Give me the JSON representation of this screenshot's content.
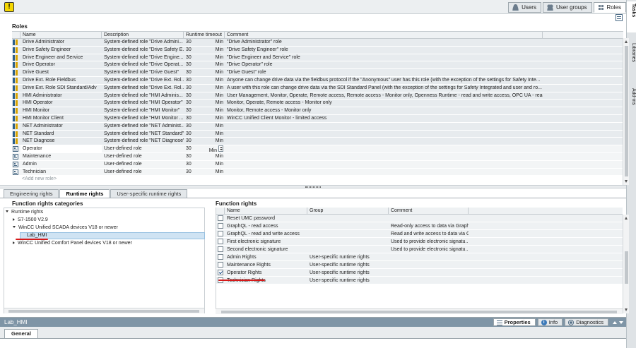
{
  "top_tabs": [
    {
      "label": "Users",
      "icon": "user-icon"
    },
    {
      "label": "User groups",
      "icon": "user-group-icon"
    },
    {
      "label": "Roles",
      "icon": "roles-icon",
      "active": true
    }
  ],
  "right_strip": {
    "tasks": "Tasks",
    "libraries": "Libraries",
    "addins": "Add-ins"
  },
  "roles": {
    "title": "Roles",
    "columns": [
      "Name",
      "Description",
      "Runtime timeout",
      "Comment"
    ],
    "rows": [
      {
        "name": "Drive Administrator",
        "desc": "System-defined role \"Drive Admini...",
        "timeout": "30",
        "unit": "Min",
        "comment": "\"Drive Administrator\" role",
        "type": "system"
      },
      {
        "name": "Drive Safety Engineer",
        "desc": "System-defined role \"Drive Safety E...",
        "timeout": "30",
        "unit": "Min",
        "comment": "\"Drive Safety Engineer\" role",
        "type": "system"
      },
      {
        "name": "Drive Engineer and Service",
        "desc": "System-defined role \"Drive Engine...",
        "timeout": "30",
        "unit": "Min",
        "comment": "\"Drive Engineer and Service\" role",
        "type": "system"
      },
      {
        "name": "Drive Operator",
        "desc": "System-defined role \"Drive Operat...",
        "timeout": "30",
        "unit": "Min",
        "comment": "\"Drive Operator\" role",
        "type": "system"
      },
      {
        "name": "Drive Guest",
        "desc": "System-defined role \"Drive Guest\"",
        "timeout": "30",
        "unit": "Min",
        "comment": "\"Drive Guest\" role",
        "type": "system"
      },
      {
        "name": "Drive Ext. Role Fieldbus",
        "desc": "System-defined role \"Drive Ext. Rol...",
        "timeout": "30",
        "unit": "Min",
        "comment": "Anyone can change drive data via the fieldbus protocol if the \"Anonymous\" user has this role (with the exception of the settings for Safety Inte...",
        "type": "system"
      },
      {
        "name": "Drive Ext. Role SDI Standard/Adv",
        "desc": "System-defined role \"Drive Ext. Rol...",
        "timeout": "30",
        "unit": "Min",
        "comment": "A user with this role can change drive data via the SDI Standard Panel (with the exception of the settings for Safety Integrated and user and ro...",
        "type": "system"
      },
      {
        "name": "HMI Administrator",
        "desc": "System-defined role \"HMI Adminis...",
        "timeout": "30",
        "unit": "Min",
        "comment": "User Management, Monitor, Operate, Remote access, Remote access - Monitor only, Openness Runtime - read and write access, OPC UA - read ...",
        "type": "system"
      },
      {
        "name": "HMI Operator",
        "desc": "System-defined role \"HMI Operator\"",
        "timeout": "30",
        "unit": "Min",
        "comment": "Monitor, Operate, Remote access - Monitor only",
        "type": "system"
      },
      {
        "name": "HMI Monitor",
        "desc": "System-defined role \"HMI Monitor\"",
        "timeout": "30",
        "unit": "Min",
        "comment": "Monitor, Remote access - Monitor only",
        "type": "system"
      },
      {
        "name": "HMI Monitor Client",
        "desc": "System-defined role \"HMI Monitor ...",
        "timeout": "30",
        "unit": "Min",
        "comment": "WinCC Unified Client Monitor - limited access",
        "type": "system"
      },
      {
        "name": "NET Administrator",
        "desc": "System-defined role \"NET Administ...",
        "timeout": "30",
        "unit": "Min",
        "comment": "",
        "type": "system"
      },
      {
        "name": "NET Standard",
        "desc": "System-defined role \"NET Standard\"",
        "timeout": "30",
        "unit": "Min",
        "comment": "",
        "type": "system"
      },
      {
        "name": "NET Diagnose",
        "desc": "System-defined role \"NET Diagnose\"",
        "timeout": "30",
        "unit": "Min",
        "comment": "",
        "type": "system"
      },
      {
        "name": "Operator",
        "desc": "User-defined role",
        "timeout": "30",
        "unit": "Min",
        "comment": "",
        "type": "user",
        "selected": true
      },
      {
        "name": "Maintenance",
        "desc": "User-defined role",
        "timeout": "30",
        "unit": "Min",
        "comment": "",
        "type": "user"
      },
      {
        "name": "Admin",
        "desc": "User-defined role",
        "timeout": "30",
        "unit": "Min",
        "comment": "",
        "type": "user"
      },
      {
        "name": "Technician",
        "desc": "User-defined role",
        "timeout": "30",
        "unit": "Min",
        "comment": "",
        "type": "user"
      }
    ],
    "add_new": "<Add new role>"
  },
  "lower_tabs": [
    "Engineering rights",
    "Runtime rights",
    "User-specific runtime rights"
  ],
  "categories": {
    "title": "Function rights categories",
    "root": "Runtime rights",
    "items": [
      {
        "label": "S7-1500 V2.9"
      },
      {
        "label": "WinCC Unified SCADA devices V18 or newer"
      },
      {
        "label": "Lab_HMI"
      },
      {
        "label": "WinCC Unified Comfort Panel devices V18 or newer"
      }
    ]
  },
  "function_rights": {
    "title": "Function rights",
    "columns": [
      "Name",
      "Group",
      "Comment"
    ],
    "rows": [
      {
        "name": "Reset UMC password",
        "group": "",
        "comment": "",
        "checked": false
      },
      {
        "name": "GraphQL - read access",
        "group": "",
        "comment": "Read-only access to data via Graph...",
        "checked": false
      },
      {
        "name": "GraphQL - read and write access",
        "group": "",
        "comment": "Read and write access to data via G...",
        "checked": false
      },
      {
        "name": "First electronic signature",
        "group": "",
        "comment": "Used to provide electronic signatu...",
        "checked": false
      },
      {
        "name": "Second electronic signature",
        "group": "",
        "comment": "Used to provide electronic signatu...",
        "checked": false
      },
      {
        "name": "Admin Rights",
        "group": "User-specific runtime rights",
        "comment": "",
        "checked": false
      },
      {
        "name": "Maintenance Rights",
        "group": "User-specific runtime rights",
        "comment": "",
        "checked": false
      },
      {
        "name": "Operator Rights",
        "group": "User-specific runtime rights",
        "comment": "",
        "checked": true
      },
      {
        "name": "Technician Rights",
        "group": "User-specific runtime rights",
        "comment": "",
        "checked": false
      }
    ]
  },
  "inspector": {
    "title": "Lab_HMI",
    "tabs": [
      "Properties",
      "Info",
      "Diagnostics"
    ],
    "general_tab": "General"
  },
  "colors": {
    "accent": "#7f95a6",
    "annotation_red": "#d61a1a",
    "selection": "#cfe3f3"
  }
}
